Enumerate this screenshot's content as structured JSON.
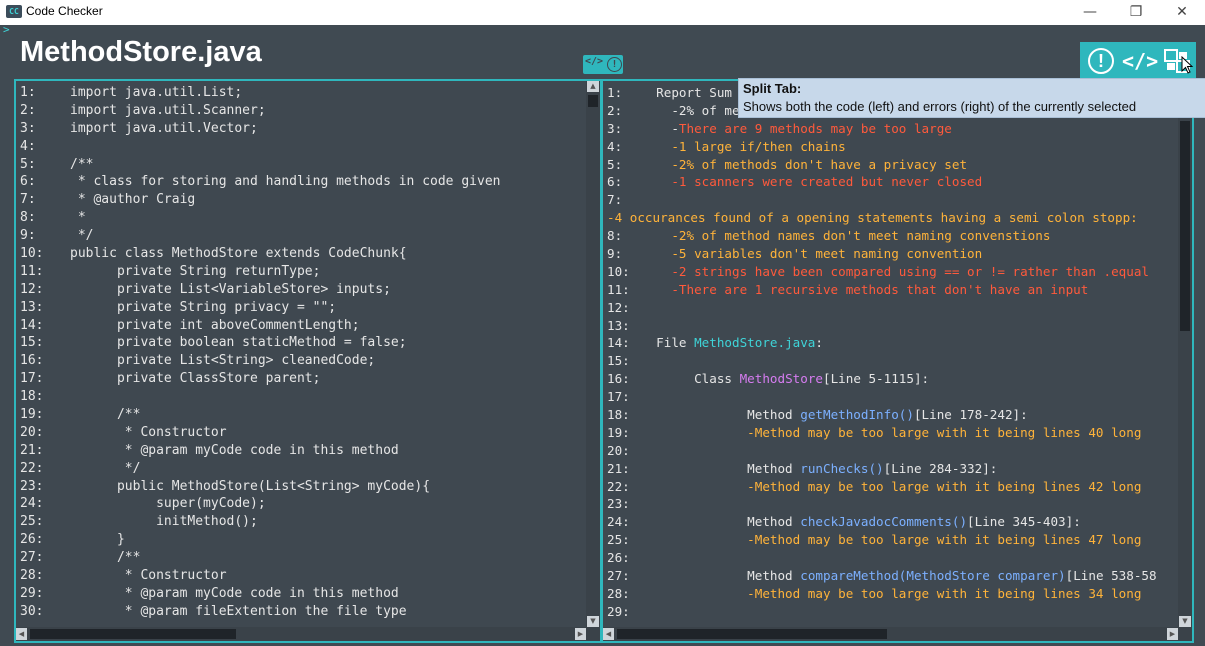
{
  "window": {
    "title": "Code Checker",
    "icon_text": "CC",
    "controls": {
      "minimize": "—",
      "maximize": "❐",
      "close": "✕"
    }
  },
  "header": {
    "file_title": "MethodStore.java",
    "caret": ">"
  },
  "toolbar": {
    "warn_icon": "!",
    "code_icon": "</>",
    "mid_code_icon": "</>",
    "mid_warn_icon": "!"
  },
  "tooltip": {
    "title": "Split Tab:",
    "body": "Shows both the code (left) and errors (right) of the currently selected"
  },
  "code_lines": [
    {
      "n": "1:",
      "t": "import java.util.List;"
    },
    {
      "n": "2:",
      "t": "import java.util.Scanner;"
    },
    {
      "n": "3:",
      "t": "import java.util.Vector;"
    },
    {
      "n": "4:",
      "t": ""
    },
    {
      "n": "5:",
      "t": "/**"
    },
    {
      "n": "6:",
      "t": " * class for storing and handling methods in code given"
    },
    {
      "n": "7:",
      "t": " * @author Craig"
    },
    {
      "n": "8:",
      "t": " *"
    },
    {
      "n": "9:",
      "t": " */"
    },
    {
      "n": "10:",
      "t": "public class MethodStore extends CodeChunk{"
    },
    {
      "n": "11:",
      "t": "      private String returnType;"
    },
    {
      "n": "12:",
      "t": "      private List<VariableStore> inputs;"
    },
    {
      "n": "13:",
      "t": "      private String privacy = \"\";"
    },
    {
      "n": "14:",
      "t": "      private int aboveCommentLength;"
    },
    {
      "n": "15:",
      "t": "      private boolean staticMethod = false;"
    },
    {
      "n": "16:",
      "t": "      private List<String> cleanedCode;"
    },
    {
      "n": "17:",
      "t": "      private ClassStore parent;"
    },
    {
      "n": "18:",
      "t": ""
    },
    {
      "n": "19:",
      "t": "      /**"
    },
    {
      "n": "20:",
      "t": "       * Constructor"
    },
    {
      "n": "21:",
      "t": "       * @param myCode code in this method"
    },
    {
      "n": "22:",
      "t": "       */"
    },
    {
      "n": "23:",
      "t": "      public MethodStore(List<String> myCode){"
    },
    {
      "n": "24:",
      "t": "           super(myCode);"
    },
    {
      "n": "25:",
      "t": "           initMethod();"
    },
    {
      "n": "26:",
      "t": "      }"
    },
    {
      "n": "27:",
      "t": "      /**"
    },
    {
      "n": "28:",
      "t": "       * Constructor"
    },
    {
      "n": "29:",
      "t": "       * @param myCode code in this method"
    },
    {
      "n": "30:",
      "t": "       * @param fileExtention the file type"
    }
  ],
  "report_lines": [
    {
      "n": "1:",
      "parts": [
        {
          "t": "  Report Sum",
          "c": ""
        }
      ]
    },
    {
      "n": "2:",
      "parts": [
        {
          "t": "    -2% of me",
          "c": ""
        }
      ]
    },
    {
      "n": "3:",
      "parts": [
        {
          "t": "    -",
          "c": ""
        },
        {
          "t": "There are 9 methods may be too large",
          "c": "red"
        }
      ]
    },
    {
      "n": "4:",
      "parts": [
        {
          "t": "    -1 large if/then chains",
          "c": "orange"
        }
      ]
    },
    {
      "n": "5:",
      "parts": [
        {
          "t": "    -2% of methods don't have a privacy set",
          "c": "orange"
        }
      ]
    },
    {
      "n": "6:",
      "parts": [
        {
          "t": "    -1 scanners were created but never closed",
          "c": "red"
        }
      ]
    },
    {
      "n": "7:",
      "parts": [
        {
          "t": "",
          "c": ""
        }
      ]
    },
    {
      "n": "",
      "parts": [
        {
          "t": "-4 occurances found of a opening statements having a semi colon stopp:",
          "c": "orange"
        }
      ]
    },
    {
      "n": "8:",
      "parts": [
        {
          "t": "    -2% of method names don't meet naming convenstions",
          "c": "orange"
        }
      ]
    },
    {
      "n": "9:",
      "parts": [
        {
          "t": "    -5 variables don't meet naming convention",
          "c": "orange"
        }
      ]
    },
    {
      "n": "10:",
      "parts": [
        {
          "t": "    -2 strings have been compared using == or != rather than .equal",
          "c": "red"
        }
      ]
    },
    {
      "n": "11:",
      "parts": [
        {
          "t": "    -There are 1 recursive methods that don't have an input",
          "c": "red"
        }
      ]
    },
    {
      "n": "12:",
      "parts": [
        {
          "t": "",
          "c": ""
        }
      ]
    },
    {
      "n": "13:",
      "parts": [
        {
          "t": "",
          "c": ""
        }
      ]
    },
    {
      "n": "14:",
      "parts": [
        {
          "t": "  File ",
          "c": ""
        },
        {
          "t": "MethodStore.java",
          "c": "teal"
        },
        {
          "t": ":",
          "c": ""
        }
      ]
    },
    {
      "n": "15:",
      "parts": [
        {
          "t": "",
          "c": ""
        }
      ]
    },
    {
      "n": "16:",
      "parts": [
        {
          "t": "       Class ",
          "c": ""
        },
        {
          "t": "MethodStore",
          "c": "purple"
        },
        {
          "t": "[Line 5-1115]:",
          "c": ""
        }
      ]
    },
    {
      "n": "17:",
      "parts": [
        {
          "t": "",
          "c": ""
        }
      ]
    },
    {
      "n": "18:",
      "parts": [
        {
          "t": "              Method ",
          "c": ""
        },
        {
          "t": "getMethodInfo()",
          "c": "blue"
        },
        {
          "t": "[Line 178-242]:",
          "c": ""
        }
      ]
    },
    {
      "n": "19:",
      "parts": [
        {
          "t": "              -Method may be too large with it being lines 40 long",
          "c": "orange"
        }
      ]
    },
    {
      "n": "20:",
      "parts": [
        {
          "t": "",
          "c": ""
        }
      ]
    },
    {
      "n": "21:",
      "parts": [
        {
          "t": "              Method ",
          "c": ""
        },
        {
          "t": "runChecks()",
          "c": "blue"
        },
        {
          "t": "[Line 284-332]:",
          "c": ""
        }
      ]
    },
    {
      "n": "22:",
      "parts": [
        {
          "t": "              -Method may be too large with it being lines 42 long",
          "c": "orange"
        }
      ]
    },
    {
      "n": "23:",
      "parts": [
        {
          "t": "",
          "c": ""
        }
      ]
    },
    {
      "n": "24:",
      "parts": [
        {
          "t": "              Method ",
          "c": ""
        },
        {
          "t": "checkJavadocComments()",
          "c": "blue"
        },
        {
          "t": "[Line 345-403]:",
          "c": ""
        }
      ]
    },
    {
      "n": "25:",
      "parts": [
        {
          "t": "              -",
          "c": "orange"
        },
        {
          "t": "Method may be too large with it being lines 47 long",
          "c": "orange"
        }
      ]
    },
    {
      "n": "26:",
      "parts": [
        {
          "t": "",
          "c": ""
        }
      ]
    },
    {
      "n": "27:",
      "parts": [
        {
          "t": "              Method ",
          "c": ""
        },
        {
          "t": "compareMethod(MethodStore comparer)",
          "c": "blue"
        },
        {
          "t": "[Line 538-58",
          "c": ""
        }
      ]
    },
    {
      "n": "28:",
      "parts": [
        {
          "t": "              -Method may be too large with it being lines 34 long",
          "c": "orange"
        }
      ]
    },
    {
      "n": "29:",
      "parts": [
        {
          "t": "",
          "c": ""
        }
      ]
    }
  ],
  "colors": {
    "accent": "#2fb7bd",
    "background": "#404a52",
    "error": "#ff5a3c",
    "warning": "#ffb33a"
  }
}
